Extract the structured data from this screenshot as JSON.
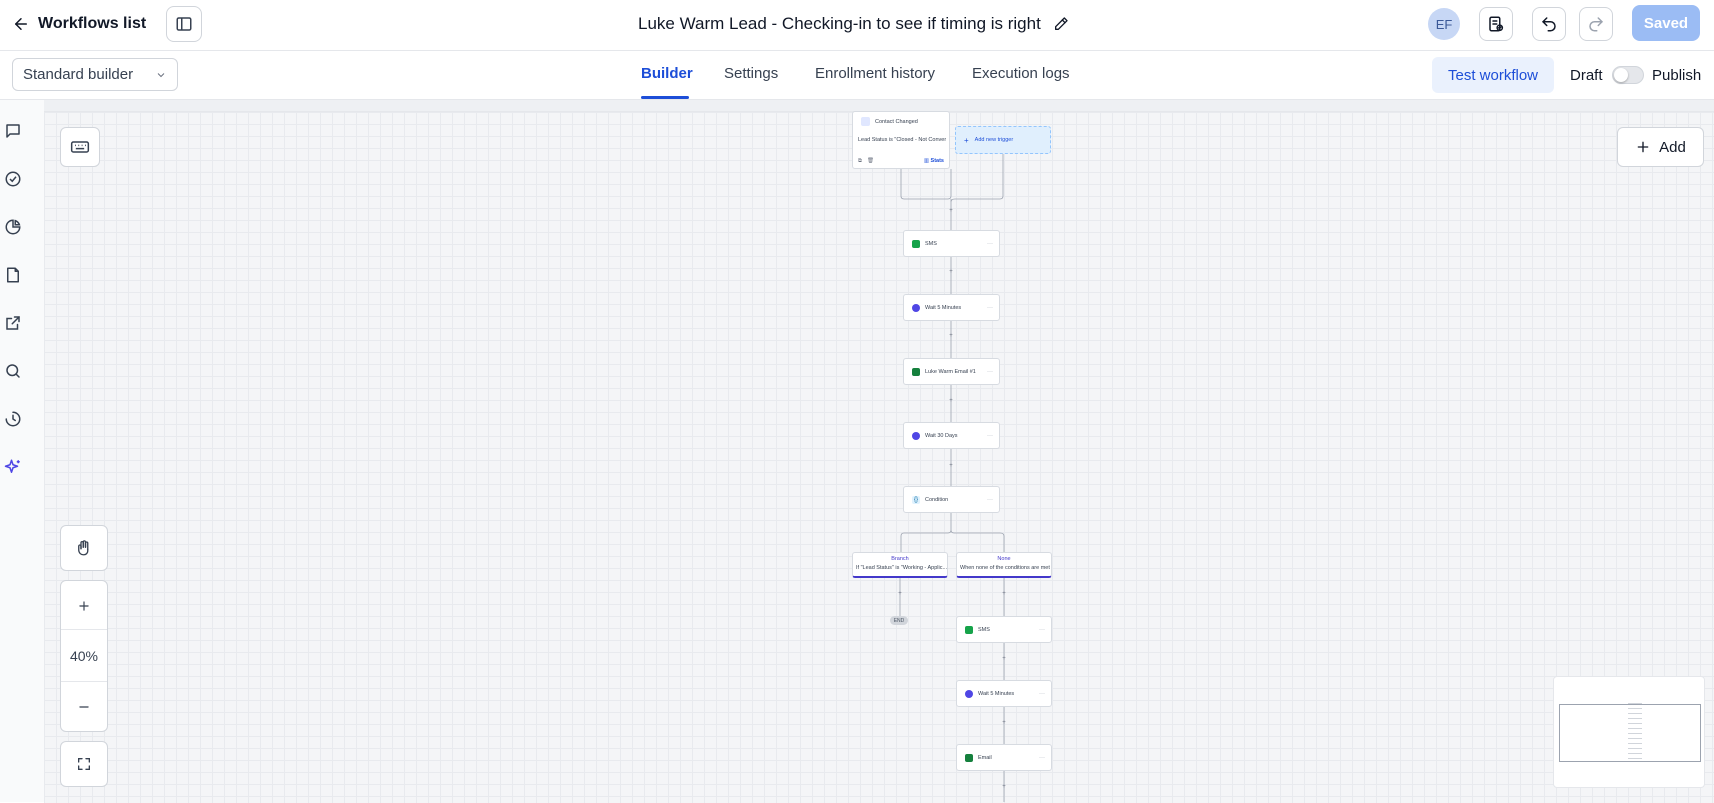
{
  "header": {
    "back_label": "Workflows list",
    "workflow_title": "Luke Warm Lead - Checking-in to see if timing is right",
    "avatar_initials": "EF",
    "saved_label": "Saved"
  },
  "subbar": {
    "builder_mode": "Standard builder",
    "tabs": [
      {
        "label": "Builder",
        "active": true
      },
      {
        "label": "Settings",
        "active": false
      },
      {
        "label": "Enrollment history",
        "active": false
      },
      {
        "label": "Execution logs",
        "active": false
      }
    ],
    "test_label": "Test workflow",
    "draft_label": "Draft",
    "publish_label": "Publish"
  },
  "canvas": {
    "zoom_level": "40%",
    "add_label": "Add",
    "trigger": {
      "title": "Contact Changed",
      "filter": "Lead Status is \"Closed - Not Conver...",
      "stats_label": "Stats"
    },
    "add_trigger_label": "Add new trigger",
    "steps": [
      {
        "label": "SMS",
        "icon": "sms-icon"
      },
      {
        "label": "Wait 5 Minutes",
        "icon": "clock-icon"
      },
      {
        "label": "Luke Warm Email #1",
        "icon": "email-icon"
      },
      {
        "label": "Wait 30 Days",
        "icon": "clock-icon"
      },
      {
        "label": "Condition",
        "icon": "condition-icon"
      }
    ],
    "branches": [
      {
        "title": "Branch",
        "subtitle": "If \"Lead Status\" is \"Working - Applic..."
      },
      {
        "title": "None",
        "subtitle": "When none of the conditions are met"
      }
    ],
    "end_label": "END",
    "none_branch_steps": [
      {
        "label": "SMS",
        "icon": "sms-icon"
      },
      {
        "label": "Wait 5 Minutes",
        "icon": "clock-icon"
      },
      {
        "label": "Email",
        "icon": "email-icon"
      }
    ]
  },
  "colors": {
    "accent": "#1d4ed8",
    "saved_button": "#9bbcf4",
    "sms_green": "#16a34a",
    "wait_purple": "#4f46e5",
    "ai_icon": "#4f46e5"
  }
}
